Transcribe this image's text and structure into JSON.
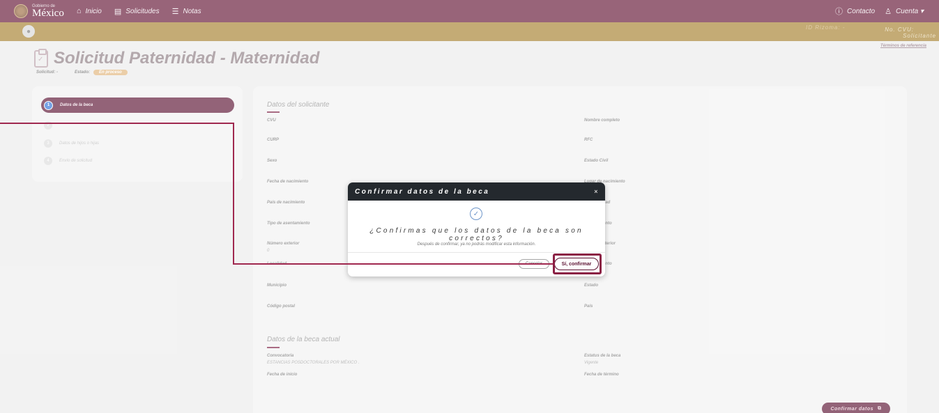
{
  "topbar": {
    "logo_small": "Gobierno de",
    "logo_big": "México",
    "nav": [
      {
        "icon": "home-icon",
        "glyph": "⌂",
        "label": "Inicio"
      },
      {
        "icon": "document-icon",
        "glyph": "▤",
        "label": "Solicitudes"
      },
      {
        "icon": "list-icon",
        "glyph": "☰",
        "label": "Notas"
      }
    ],
    "contacto": {
      "glyph": "ⓘ",
      "label": "Contacto"
    },
    "cuenta": {
      "glyph": "♙",
      "label": "Cuenta ▾"
    }
  },
  "userbar": {
    "rizoma": "ID Rizoma: -",
    "cvu": "No. CVU:",
    "role": "Solicitante"
  },
  "terminos": "Términos de referencia",
  "page": {
    "title": "Solicitud Paternidad - Maternidad",
    "solicitud_label": "Solicitud: -",
    "estado_label": "Estado:",
    "estado_badge": "En proceso"
  },
  "steps": {
    "active": {
      "num": "1",
      "label": "Datos de la beca"
    },
    "items": [
      {
        "num": "2",
        "label": ""
      },
      {
        "num": "3",
        "label": "Datos de hijos o hijas"
      },
      {
        "num": "4",
        "label": "Envío de solicitud"
      }
    ]
  },
  "solicitante": {
    "title": "Datos del solicitante",
    "left": [
      {
        "label": "CVU",
        "value": ""
      },
      {
        "label": "CURP",
        "value": ""
      },
      {
        "label": "Sexo",
        "value": ""
      },
      {
        "label": "Fecha de nacimiento",
        "value": ""
      },
      {
        "label": "País de nacimiento",
        "value": ""
      },
      {
        "label": "Tipo de asentamiento",
        "value": ""
      },
      {
        "label": "Número exterior",
        "value": "0"
      },
      {
        "label": "Localidad",
        "value": ""
      },
      {
        "label": "Municipio",
        "value": ""
      },
      {
        "label": "Código postal",
        "value": ""
      }
    ],
    "right": [
      {
        "label": "Nombre completo",
        "value": ""
      },
      {
        "label": "RFC",
        "value": ""
      },
      {
        "label": "Estado Civil",
        "value": ""
      },
      {
        "label": "Lugar de nacimiento",
        "value": ""
      },
      {
        "label": "Nacionalidad",
        "value": ""
      },
      {
        "label": "Asentamiento",
        "value": ""
      },
      {
        "label": "Número interior",
        "value": ""
      },
      {
        "label": "Asentamiento",
        "value": ""
      },
      {
        "label": "Estado",
        "value": ""
      },
      {
        "label": "País",
        "value": ""
      }
    ]
  },
  "beca": {
    "title": "Datos de la beca actual",
    "convocatoria_label": "Convocatoria",
    "convocatoria_value": "ESTANCIAS POSDOCTORALES POR MÉXICO .",
    "estatus_label": "Estatus de la beca",
    "estatus_value": "Vigente",
    "inicio_label": "Fecha de inicio",
    "termino_label": "Fecha de término"
  },
  "confirm_data_button": "Confirmar datos",
  "modal": {
    "title": "Confirmar datos de la beca",
    "close": "×",
    "question": "¿Confirmas que los datos de la beca son correctos?",
    "note": "Después de confirmar, ya no podrás modificar esta información.",
    "cancel": "Cancelar",
    "confirm": "Sí, confirmar"
  },
  "colors": {
    "primary": "#611232",
    "gold": "#a57f2c",
    "accent_blue": "#2c6fd6",
    "annotation": "#8b1f44"
  }
}
